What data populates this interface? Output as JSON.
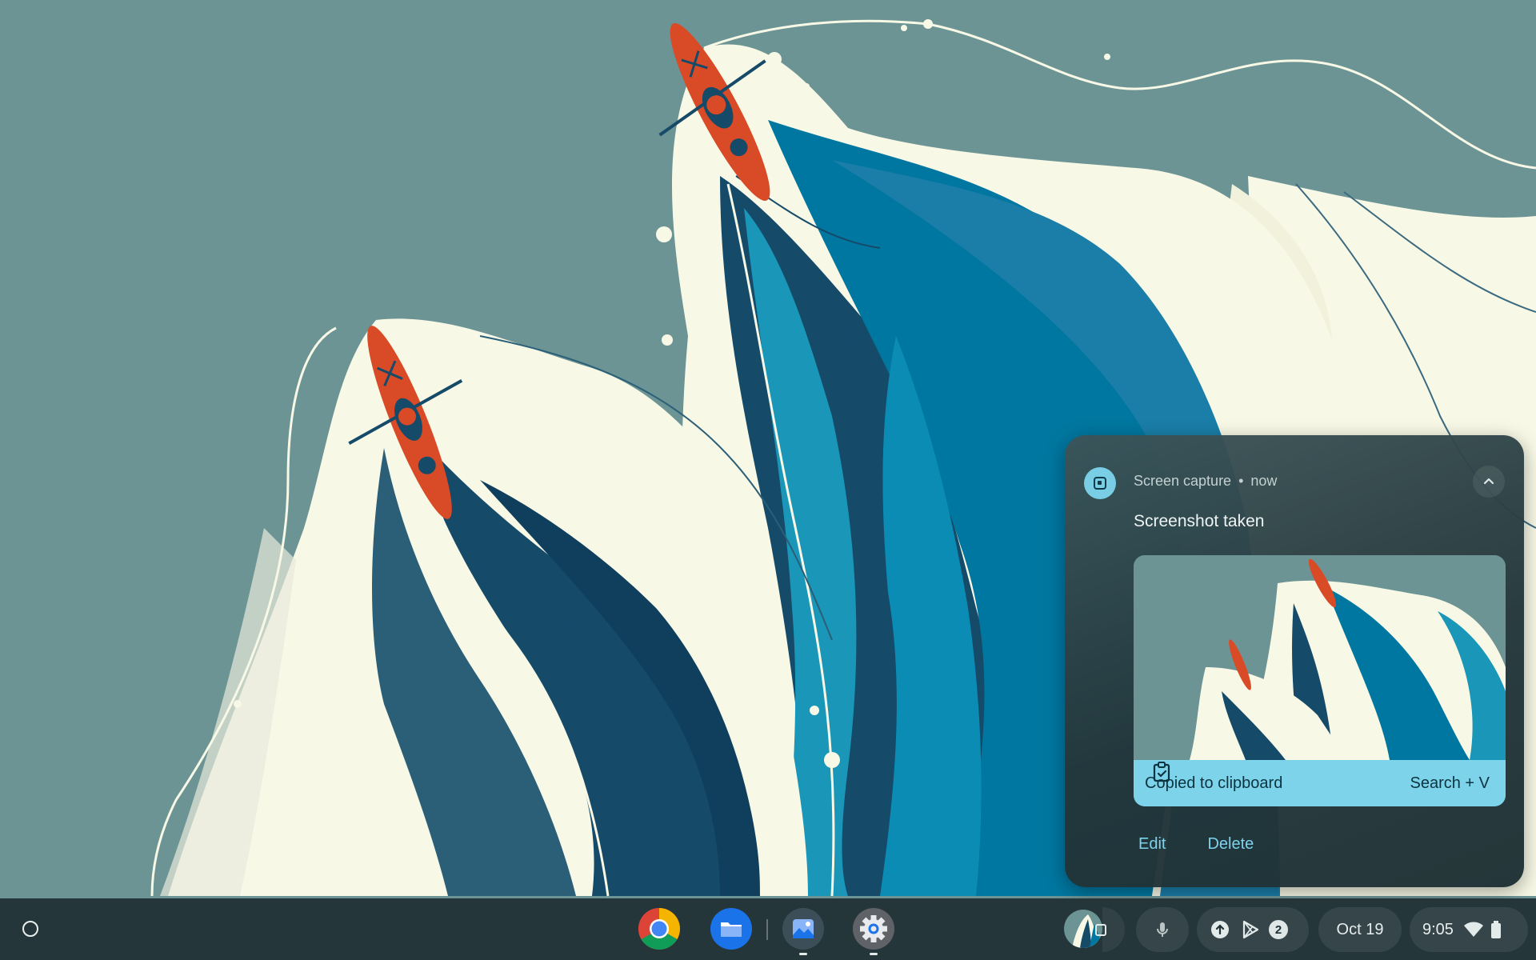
{
  "notification": {
    "app_name": "Screen capture",
    "separator": "•",
    "time": "now",
    "title": "Screenshot taken",
    "clipboard_label": "Copied to clipboard",
    "clipboard_shortcut": "Search + V",
    "actions": [
      "Edit",
      "Delete"
    ]
  },
  "shelf": {
    "apps": [
      {
        "name": "Chrome",
        "icon": "chrome-icon",
        "running": false
      },
      {
        "name": "Files",
        "icon": "files-folder-icon",
        "running": false
      },
      {
        "name": "Gallery",
        "icon": "gallery-icon",
        "running": true
      },
      {
        "name": "Settings",
        "icon": "settings-gear-icon",
        "running": true
      }
    ],
    "tray": {
      "notification_count": "2",
      "date": "Oct 19",
      "time": "9:05"
    }
  },
  "colors": {
    "sky": "#6c9495",
    "cream": "#f8f8e6",
    "navy": "#154a69",
    "teal_blue": "#0077a0",
    "bright_blue": "#1a96b8",
    "kayak": "#d94a26",
    "accent": "#7fd2ec"
  }
}
